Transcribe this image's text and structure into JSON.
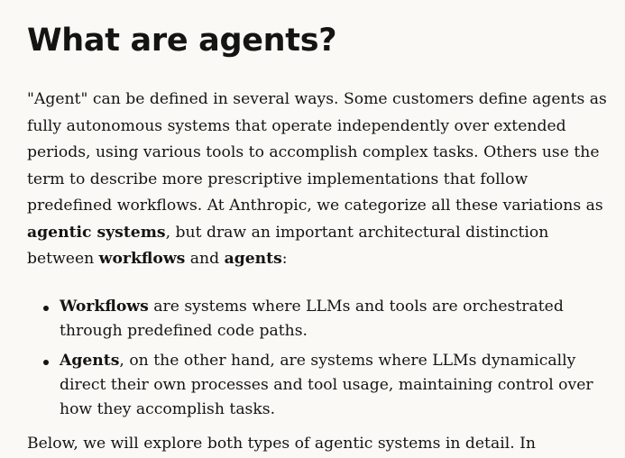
{
  "article": {
    "heading": "What are agents?",
    "intro": {
      "part1": "\"Agent\" can be defined in several ways. Some customers define agents as fully autonomous systems that operate independently over extended periods, using various tools to accomplish complex tasks. Others use the term to describe more prescriptive implementations that follow predefined workflows. At Anthropic, we categorize all these variations as ",
      "bold1": "agentic systems",
      "part2": ", but draw an important architectural distinction between ",
      "bold2": "workflows",
      "part3": " and ",
      "bold3": "agents",
      "part4": ":"
    },
    "bullets": [
      {
        "term": "Workflows",
        "text": " are systems where LLMs and tools are orchestrated through predefined code paths."
      },
      {
        "term": "Agents",
        "text": ", on the other hand, are systems where LLMs dynamically direct their own processes and tool usage, maintaining control over how they accomplish tasks."
      }
    ],
    "tail": "Below, we will explore both types of agentic systems in detail. In"
  }
}
